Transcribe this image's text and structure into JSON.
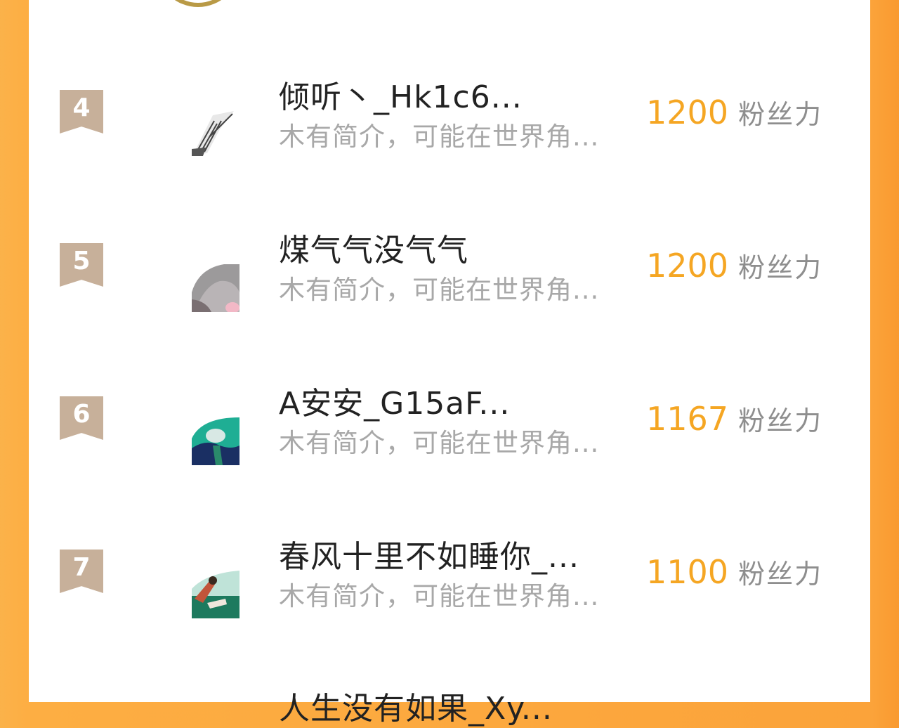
{
  "ranking": {
    "rows": [
      {
        "rank": "4",
        "name": "倾听丶_Hk1c6...",
        "bio": "木有简介，可能在世界角...",
        "score": "1200",
        "unit": "粉丝力"
      },
      {
        "rank": "5",
        "name": "煤气气没气气",
        "bio": "木有简介，可能在世界角...",
        "score": "1200",
        "unit": "粉丝力"
      },
      {
        "rank": "6",
        "name": "A安安_G15aF...",
        "bio": "木有简介，可能在世界角...",
        "score": "1167",
        "unit": "粉丝力"
      },
      {
        "rank": "7",
        "name": "春风十里不如睡你_...",
        "bio": "木有简介，可能在世界角...",
        "score": "1100",
        "unit": "粉丝力"
      }
    ],
    "next_partial_name": "人生没有如果_Xy..."
  },
  "colors": {
    "accent": "#f5a623",
    "rank_badge": "#c7b09a",
    "side_gradient": "#fba33a"
  }
}
